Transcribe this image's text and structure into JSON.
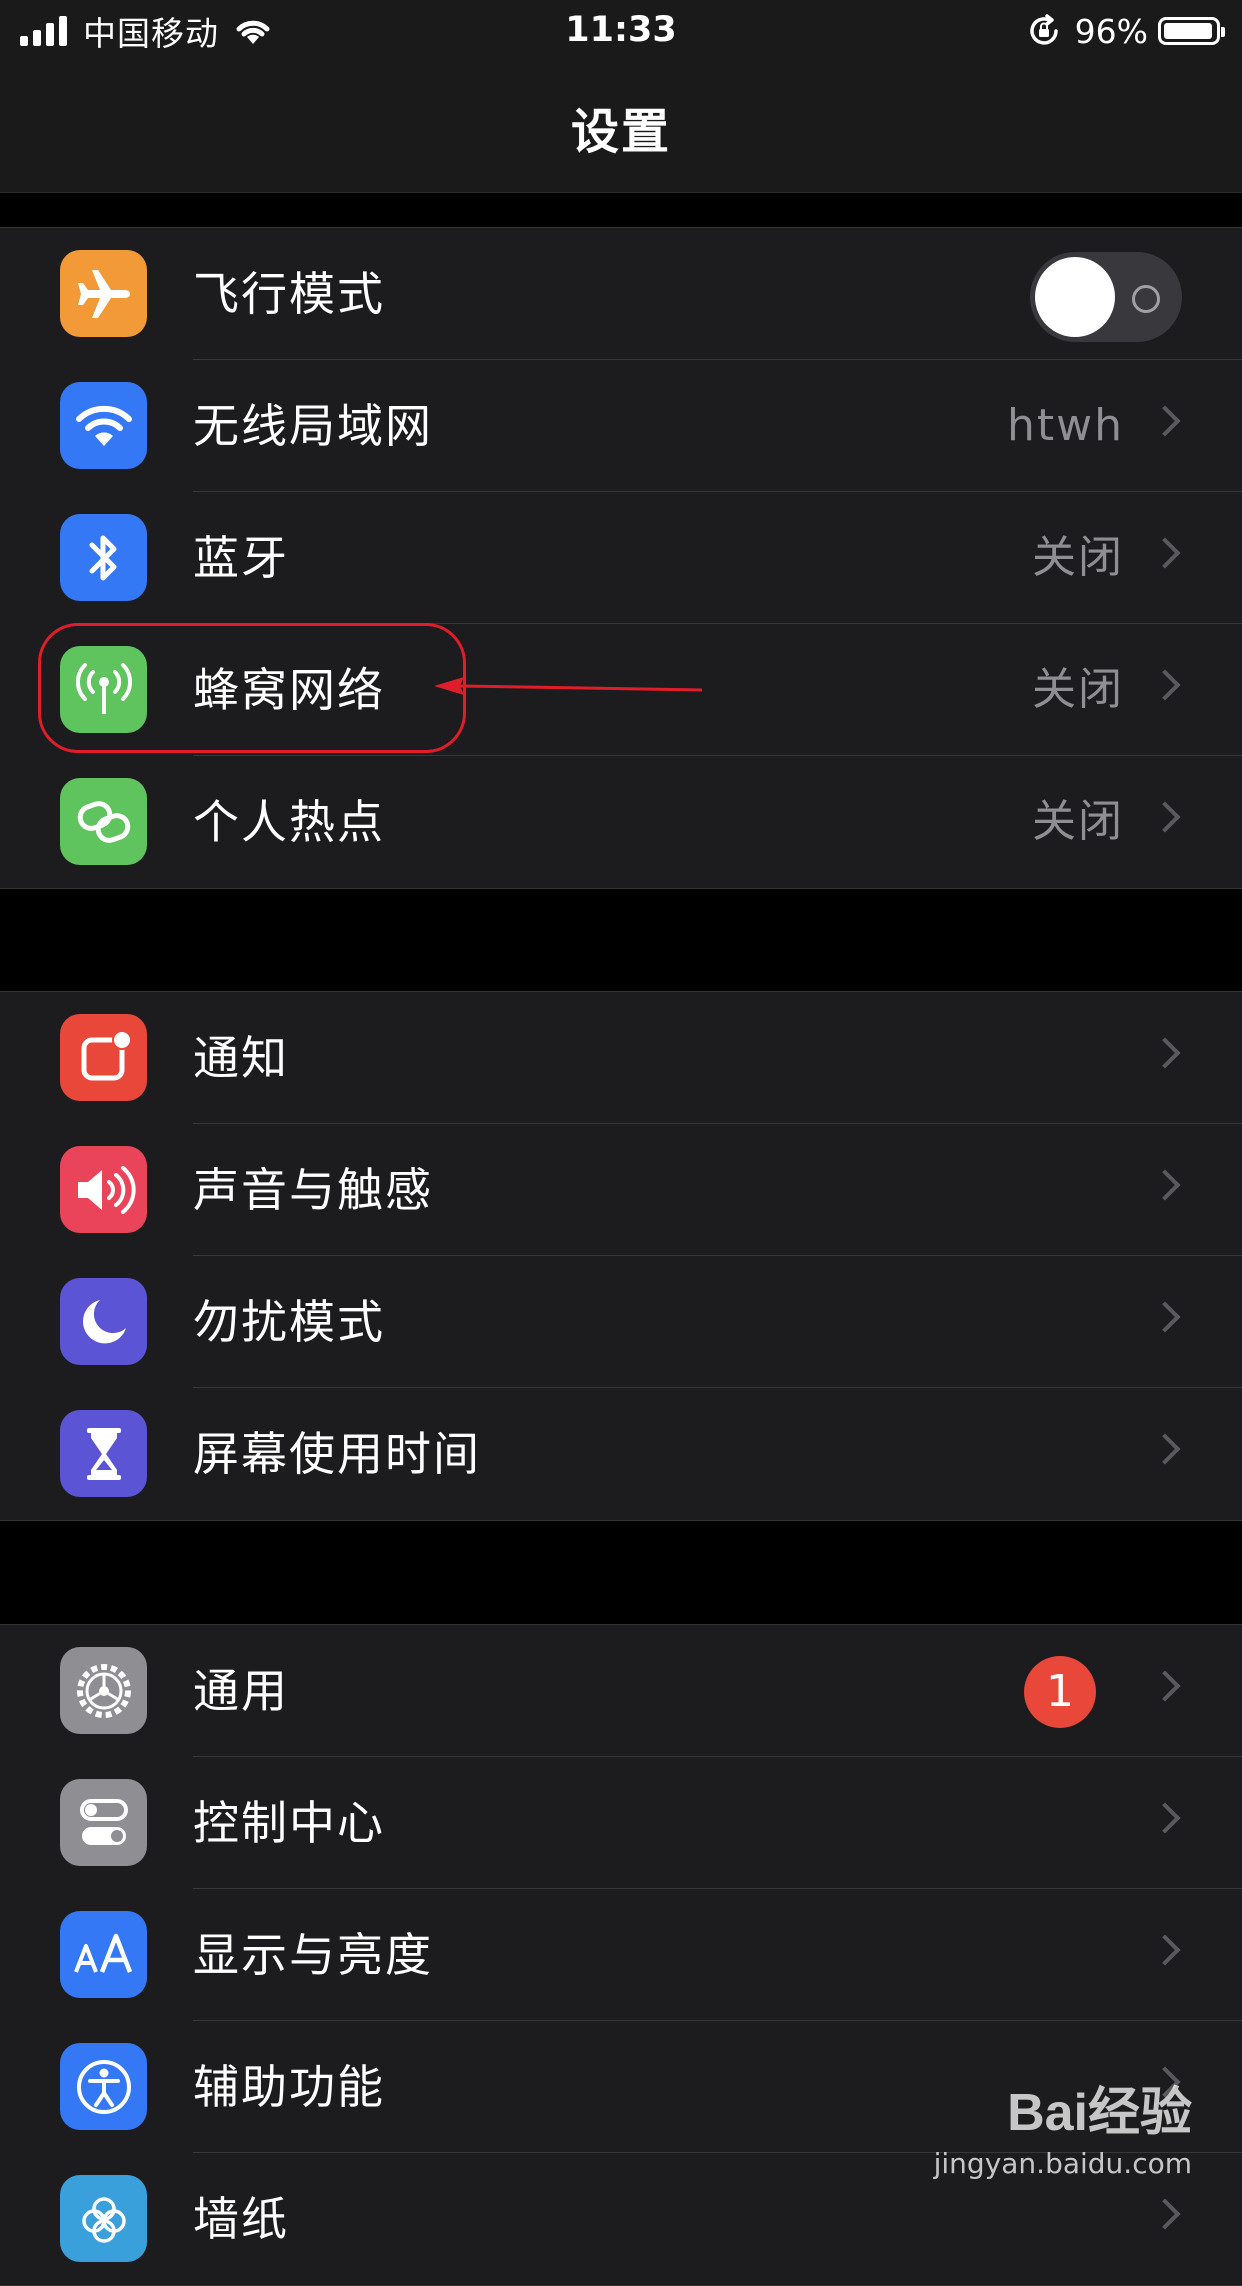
{
  "status_bar": {
    "carrier": "中国移动",
    "time": "11:33",
    "battery": "96%",
    "battery_level": 0.96
  },
  "nav": {
    "title": "设置"
  },
  "groups": [
    {
      "rows": [
        {
          "label": "飞行模式",
          "icon": "airplane-icon",
          "icon_bg": "#f19a37",
          "control": "toggle",
          "toggle_on": false
        },
        {
          "label": "无线局域网",
          "icon": "wifi-icon",
          "icon_bg": "#3478f6",
          "value": "htwh"
        },
        {
          "label": "蓝牙",
          "icon": "bluetooth-icon",
          "icon_bg": "#3478f6",
          "value": "关闭"
        },
        {
          "label": "蜂窝网络",
          "icon": "cellular-antenna-icon",
          "icon_bg": "#5fc35e",
          "value": "关闭"
        },
        {
          "label": "个人热点",
          "icon": "hotspot-link-icon",
          "icon_bg": "#5fc35e",
          "value": "关闭"
        }
      ]
    },
    {
      "rows": [
        {
          "label": "通知",
          "icon": "notification-icon",
          "icon_bg": "#e8473a"
        },
        {
          "label": "声音与触感",
          "icon": "speaker-icon",
          "icon_bg": "#e9445a"
        },
        {
          "label": "勿扰模式",
          "icon": "moon-icon",
          "icon_bg": "#5b55d6"
        },
        {
          "label": "屏幕使用时间",
          "icon": "hourglass-icon",
          "icon_bg": "#5b55d6"
        }
      ]
    },
    {
      "rows": [
        {
          "label": "通用",
          "icon": "gear-icon",
          "icon_bg": "#8e8e93",
          "badge": "1"
        },
        {
          "label": "控制中心",
          "icon": "switches-icon",
          "icon_bg": "#8e8e93"
        },
        {
          "label": "显示与亮度",
          "icon": "text-size-icon",
          "icon_bg": "#3478f6"
        },
        {
          "label": "辅助功能",
          "icon": "accessibility-icon",
          "icon_bg": "#3478f6"
        },
        {
          "label": "墙纸",
          "icon": "wallpaper-icon",
          "icon_bg": "#3aa0dc"
        }
      ]
    }
  ],
  "annotation_color": "#e11d2b",
  "watermark": {
    "logo": "Bai经验",
    "url": "jingyan.baidu.com"
  }
}
